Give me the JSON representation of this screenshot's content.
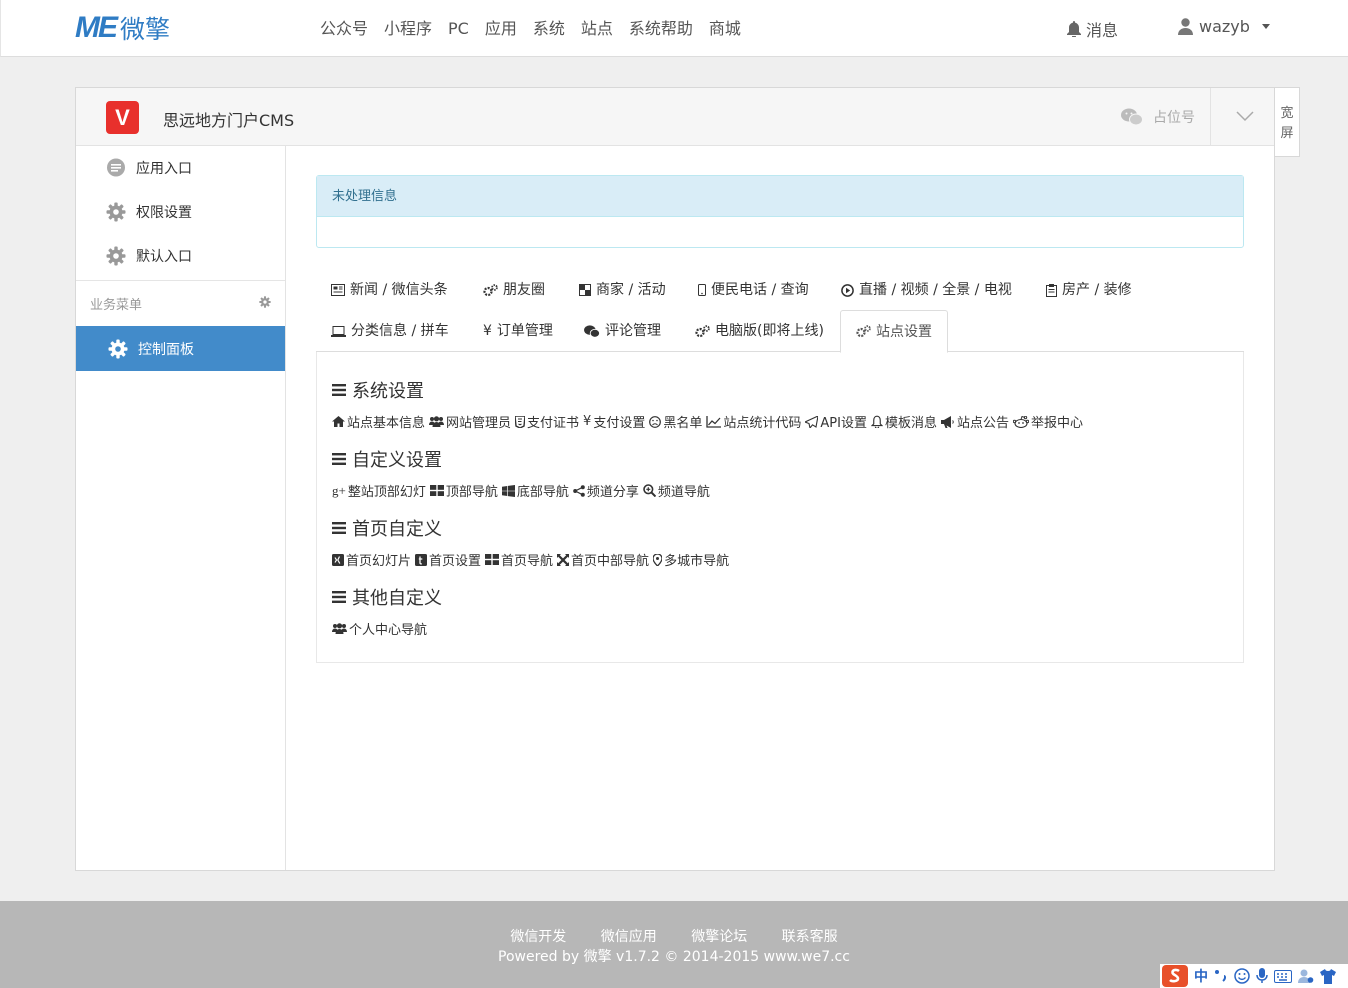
{
  "brand": {
    "logo_mark": "ME",
    "logo_text": "微擎",
    "color": "#2f7cc4"
  },
  "nav": [
    "公众号",
    "小程序",
    "PC",
    "应用",
    "系统",
    "站点",
    "系统帮助",
    "商城"
  ],
  "top": {
    "messages": "消息",
    "username": "wazyb"
  },
  "app": {
    "icon_text": "V",
    "name": "思远地方门户CMS",
    "placeholder": "占位号"
  },
  "wide_screen": "宽屏",
  "sidebar": {
    "items": [
      {
        "label": "应用入口",
        "icon": "chat-icon"
      },
      {
        "label": "权限设置",
        "icon": "gear-icon"
      },
      {
        "label": "默认入口",
        "icon": "gear-icon"
      }
    ],
    "group_label": "业务菜单",
    "active_label": "控制面板"
  },
  "alert": {
    "title": "未处理信息"
  },
  "tabs": [
    {
      "label": "新闻 / 微信头条",
      "icon": "newspaper-icon"
    },
    {
      "label": "朋友圈",
      "icon": "cogs-icon"
    },
    {
      "label": "商家 / 活动",
      "icon": "checker-icon"
    },
    {
      "label": "便民电话 / 查询",
      "icon": "mobile-icon"
    },
    {
      "label": "直播 / 视频 / 全景 / 电视",
      "icon": "play-icon"
    },
    {
      "label": "房产 / 装修",
      "icon": "clipboard-icon"
    },
    {
      "label": "分类信息 / 拼车",
      "icon": "laptop-icon"
    },
    {
      "label": "订单管理",
      "icon": "yen-icon"
    },
    {
      "label": "评论管理",
      "icon": "wechat-icon"
    },
    {
      "label": "电脑版(即将上线)",
      "icon": "cogs-icon"
    },
    {
      "label": "站点设置",
      "icon": "cogs-icon",
      "active": true
    }
  ],
  "sections": [
    {
      "title": "系统设置",
      "links": [
        {
          "label": "站点基本信息",
          "icon": "home-icon"
        },
        {
          "label": "网站管理员",
          "icon": "users-icon"
        },
        {
          "label": "支付证书",
          "icon": "html5-icon"
        },
        {
          "label": "支付设置",
          "icon": "yen-icon"
        },
        {
          "label": "黑名单",
          "icon": "frown-icon"
        },
        {
          "label": "站点统计代码",
          "icon": "line-chart-icon"
        },
        {
          "label": "API设置",
          "icon": "paper-plane-icon"
        },
        {
          "label": "模板消息",
          "icon": "bell-icon"
        },
        {
          "label": "站点公告",
          "icon": "bullhorn-icon"
        },
        {
          "label": "举报中心",
          "icon": "reddit-icon"
        }
      ]
    },
    {
      "title": "自定义设置",
      "links": [
        {
          "label": "整站顶部幻灯",
          "icon": "google-plus-icon"
        },
        {
          "label": "顶部导航",
          "icon": "th-large-icon"
        },
        {
          "label": "底部导航",
          "icon": "windows-icon"
        },
        {
          "label": "频道分享",
          "icon": "share-alt-icon"
        },
        {
          "label": "频道导航",
          "icon": "search-plus-icon"
        }
      ]
    },
    {
      "title": "首页自定义",
      "links": [
        {
          "label": "首页幻灯片",
          "icon": "xing-icon"
        },
        {
          "label": "首页设置",
          "icon": "tumblr-icon"
        },
        {
          "label": "首页导航",
          "icon": "th-large-icon"
        },
        {
          "label": "首页中部导航",
          "icon": "arrows-icon"
        },
        {
          "label": "多城市导航",
          "icon": "map-marker-icon"
        }
      ]
    },
    {
      "title": "其他自定义",
      "links": [
        {
          "label": "个人中心导航",
          "icon": "users-icon"
        }
      ]
    }
  ],
  "footer": {
    "links": [
      "微信开发",
      "微信应用",
      "微擎论坛",
      "联系客服"
    ],
    "copyright": "Powered by 微擎 v1.7.2 © 2014-2015 www.we7.cc"
  },
  "ime": {
    "lang": "中"
  },
  "colors": {
    "active": "#428bca",
    "alert_bg": "#d9edf7",
    "alert_text": "#31708f",
    "footer": "#b7b7b7"
  }
}
